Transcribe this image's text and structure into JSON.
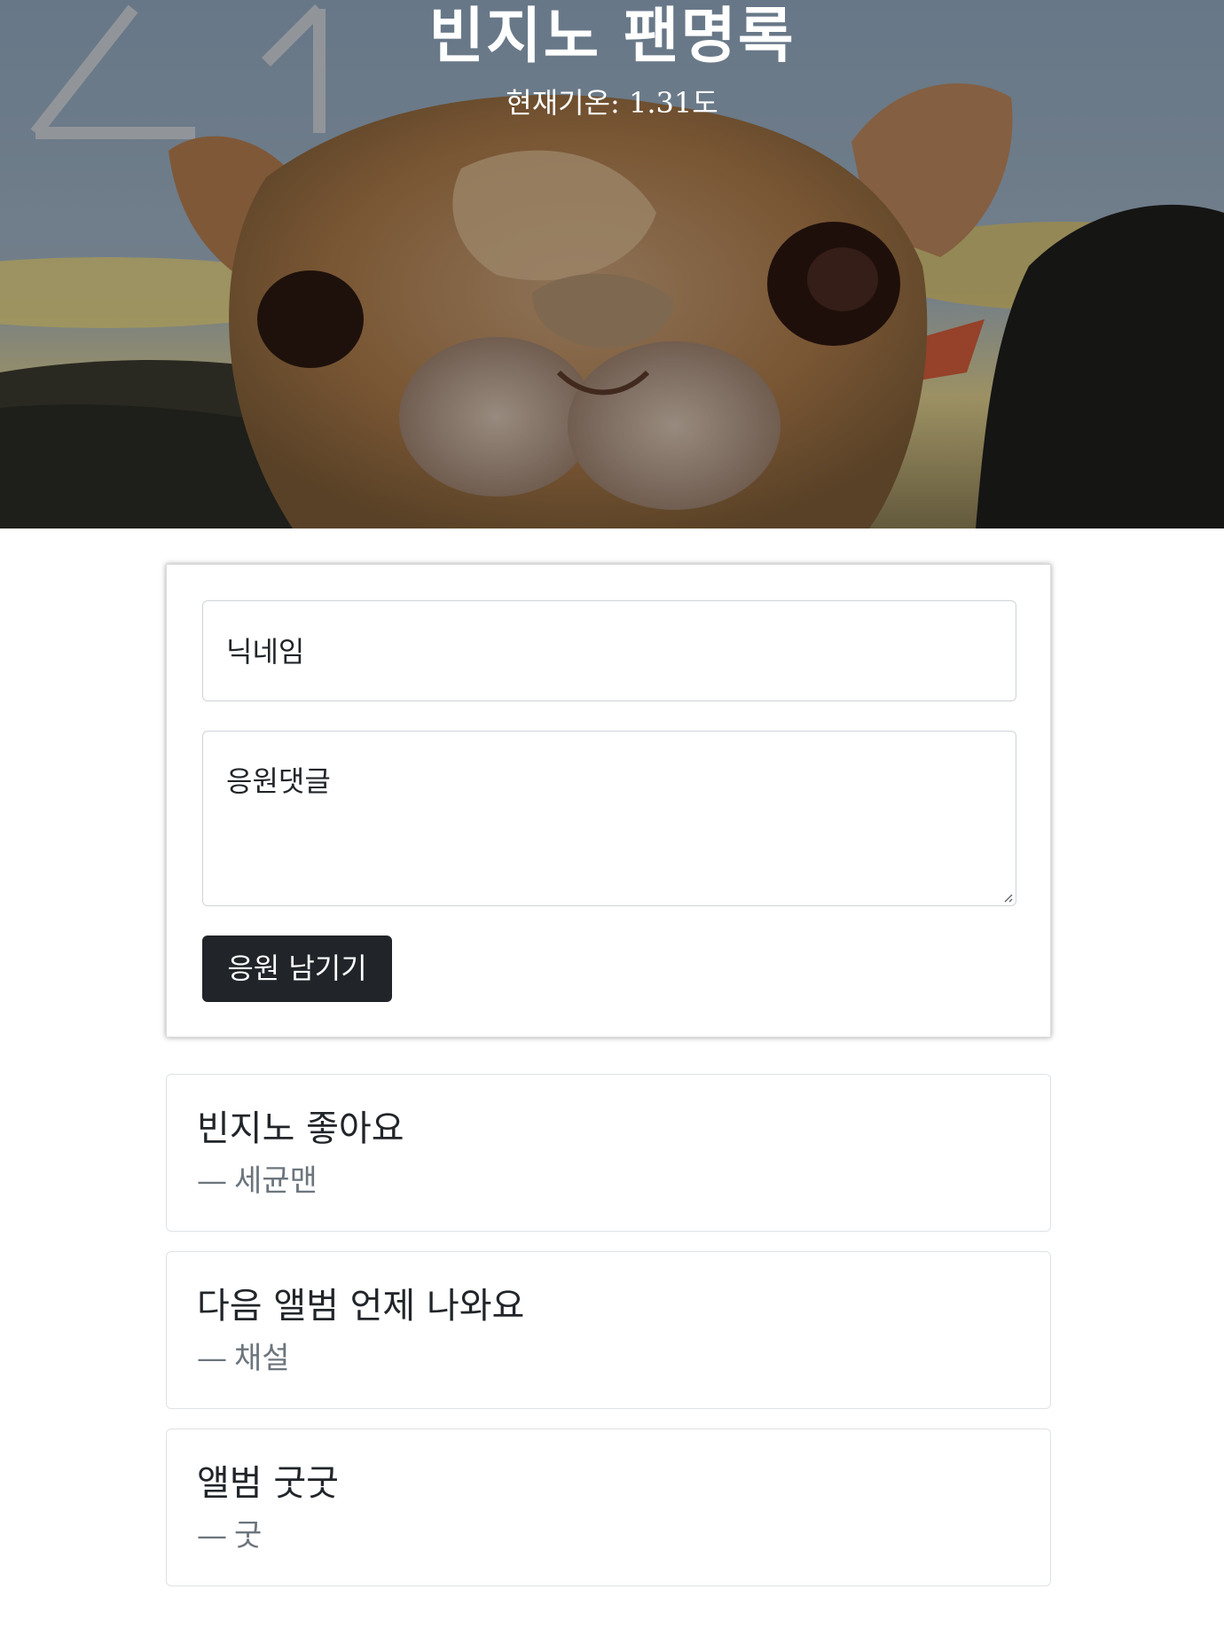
{
  "header": {
    "title": "빈지노 팬명록",
    "temperature_label": "현재기온: ",
    "temperature_value": "1.31",
    "temperature_unit": "도"
  },
  "form": {
    "nickname_placeholder": "닉네임",
    "comment_placeholder": "응원댓글",
    "submit_label": "응원 남기기"
  },
  "comments": [
    {
      "text": "빈지노 좋아요",
      "author": "세균맨"
    },
    {
      "text": "다음 앨범 언제 나와요",
      "author": "채설"
    },
    {
      "text": "앨범 굿굿",
      "author": "굿"
    }
  ],
  "author_prefix": "—",
  "colors": {
    "button_bg": "#212529",
    "author_text": "#6c757d",
    "card_border": "#dee2e6"
  },
  "hero_image": "painted-camel-face"
}
